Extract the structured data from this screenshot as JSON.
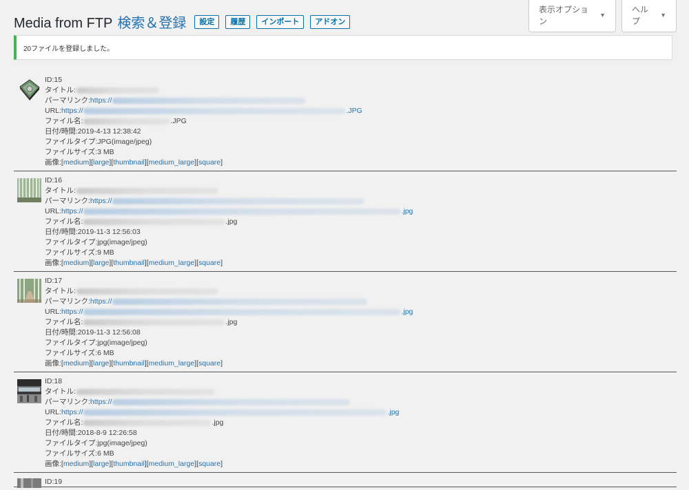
{
  "screen_options": {
    "display_options": "表示オプション",
    "help": "ヘルプ"
  },
  "header": {
    "title": "Media from FTP",
    "title_accent": "検索＆登録",
    "tabs": [
      "設定",
      "履歴",
      "インポート",
      "アドオン"
    ]
  },
  "notice": {
    "message": "20ファイルを登録しました。"
  },
  "labels": {
    "id": "ID: ",
    "title": "タイトル: ",
    "permalink": "パーマリンク: ",
    "url": "URL: ",
    "filename": "ファイル名: ",
    "datetime": "日付/時間: ",
    "filetype": "ファイルタイプ: ",
    "filesize": "ファイルサイズ: ",
    "images": "画像: "
  },
  "image_sizes": [
    "medium",
    "large",
    "thumbnail",
    "medium_large",
    "square"
  ],
  "items": [
    {
      "id": "15",
      "permalink_prefix": "https://",
      "url_prefix": "https://",
      "url_ext": ".JPG",
      "file_ext": ".JPG",
      "date": "2019-4-13 12:38:42",
      "filetype": "JPG(image/jpeg)",
      "filesize": "3 MB",
      "thumb_icon": "server-drive-thumbnail"
    },
    {
      "id": "16",
      "permalink_prefix": "https://",
      "url_prefix": "https://",
      "url_ext": ".jpg",
      "file_ext": ".jpg",
      "date": "2019-11-3 12:56:03",
      "filetype": "jpg(image/jpeg)",
      "filesize": "9 MB",
      "thumb_icon": "bamboo-forest-thumbnail"
    },
    {
      "id": "17",
      "permalink_prefix": "https://",
      "url_prefix": "https://",
      "url_ext": ".jpg",
      "file_ext": ".jpg",
      "date": "2019-11-3 12:56:08",
      "filetype": "jpg(image/jpeg)",
      "filesize": "6 MB",
      "thumb_icon": "bamboo-path-thumbnail"
    },
    {
      "id": "18",
      "permalink_prefix": "https://",
      "url_prefix": "https://",
      "url_ext": ".jpg",
      "file_ext": ".jpg",
      "date": "2018-8-9 12:26:58",
      "filetype": "jpg(image/jpeg)",
      "filesize": "6 MB",
      "thumb_icon": "train-station-thumbnail"
    }
  ],
  "partial_item": {
    "id": "19"
  }
}
